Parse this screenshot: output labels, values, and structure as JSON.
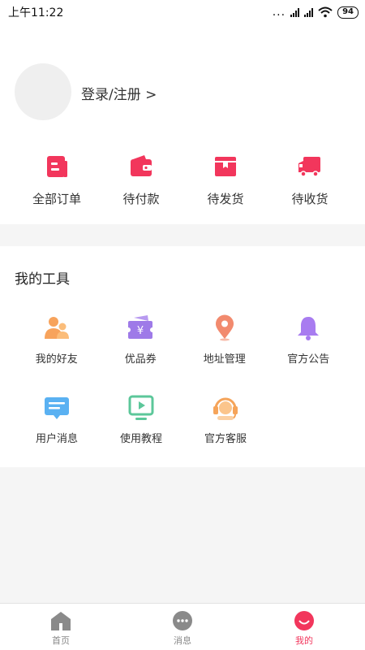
{
  "status_bar": {
    "time": "上午11:22",
    "dots": "...",
    "battery": "94"
  },
  "profile": {
    "login_text": "登录/注册 >"
  },
  "orders": [
    {
      "label": "全部订单",
      "icon": "order-list-icon"
    },
    {
      "label": "待付款",
      "icon": "wallet-icon"
    },
    {
      "label": "待发货",
      "icon": "package-icon"
    },
    {
      "label": "待收货",
      "icon": "truck-icon"
    }
  ],
  "tools": {
    "title": "我的工具",
    "items": [
      {
        "label": "我的好友",
        "icon": "friends-icon"
      },
      {
        "label": "优品券",
        "icon": "coupon-icon"
      },
      {
        "label": "地址管理",
        "icon": "location-icon"
      },
      {
        "label": "官方公告",
        "icon": "bell-icon"
      },
      {
        "label": "用户消息",
        "icon": "message-icon"
      },
      {
        "label": "使用教程",
        "icon": "video-icon"
      },
      {
        "label": "官方客服",
        "icon": "headset-icon"
      }
    ]
  },
  "nav": [
    {
      "label": "首页",
      "icon": "home-icon"
    },
    {
      "label": "消息",
      "icon": "chat-icon"
    },
    {
      "label": "我的",
      "icon": "profile-smile-icon"
    }
  ],
  "colors": {
    "accent": "#f2365c",
    "friends": "#f7a35c",
    "coupon": "#9e7ae8",
    "location": "#f28a6e",
    "bell": "#a87cf0",
    "message": "#5ab1f2",
    "video": "#5cc79a",
    "headset": "#f5a45a"
  }
}
